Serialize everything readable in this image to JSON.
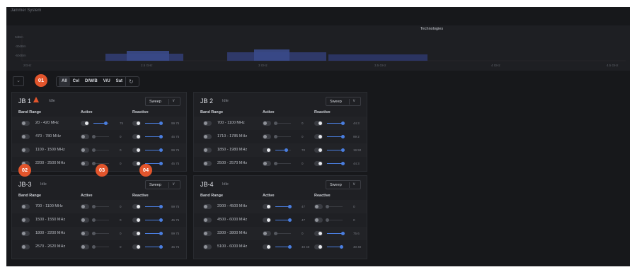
{
  "app": {
    "title": "Jammer System"
  },
  "spectrum": {
    "technologies_label": "Technologies",
    "y_labels": [
      "0dBm",
      "-30dBm",
      "-60dBm"
    ],
    "freq_labels": [
      "2GHz",
      "2.5 GHz",
      "3 GHz",
      "3.5 GHz",
      "4 GHz",
      "4.5 GHz"
    ]
  },
  "toolbar": {
    "filters": [
      "All",
      "Cel",
      "D/W/B",
      "V/U",
      "Sat"
    ],
    "selected_filter": "All"
  },
  "badges": [
    "01",
    "02",
    "03",
    "04"
  ],
  "panels": [
    {
      "title": "JB 1",
      "status": "Idle",
      "warning": true,
      "mode": "Sweep",
      "headers": {
        "band": "Band Range",
        "active": "Active",
        "reactive": "Reactive"
      },
      "rows": [
        {
          "band": "20 - 420 MHz",
          "active_on": true,
          "active_level": 0.75,
          "active_val": "75",
          "reactive_on": true,
          "reactive_level": 1.0,
          "reactive_val": "99 75"
        },
        {
          "band": "470 - 780 MHz",
          "active_on": false,
          "active_level": 0.0,
          "active_val": "0",
          "reactive_on": true,
          "reactive_level": 1.0,
          "reactive_val": "45 75"
        },
        {
          "band": "1100 - 1500 MHz",
          "active_on": false,
          "active_level": 0.0,
          "active_val": "0",
          "reactive_on": true,
          "reactive_level": 1.0,
          "reactive_val": "99 75"
        },
        {
          "band": "2200 - 2500 MHz",
          "active_on": false,
          "active_level": 0.0,
          "active_val": "0",
          "reactive_on": true,
          "reactive_level": 1.0,
          "reactive_val": "45 75"
        }
      ]
    },
    {
      "title": "JB 2",
      "status": "Idle",
      "warning": false,
      "mode": "Sweep",
      "headers": {
        "band": "Band Range",
        "active": "Active",
        "reactive": "Reactive"
      },
      "rows": [
        {
          "band": "700 - 1100 MHz",
          "active_on": false,
          "active_level": 0.0,
          "active_val": "0",
          "reactive_on": true,
          "reactive_level": 1.0,
          "reactive_val": "44 3"
        },
        {
          "band": "1710 - 1785 MHz",
          "active_on": false,
          "active_level": 0.0,
          "active_val": "0",
          "reactive_on": true,
          "reactive_level": 1.0,
          "reactive_val": "99 2"
        },
        {
          "band": "1850 - 1980 MHz",
          "active_on": true,
          "active_level": 0.7,
          "active_val": "70",
          "reactive_on": true,
          "reactive_level": 1.0,
          "reactive_val": "19 50"
        },
        {
          "band": "2500 - 2570 MHz",
          "active_on": false,
          "active_level": 0.0,
          "active_val": "0",
          "reactive_on": true,
          "reactive_level": 1.0,
          "reactive_val": "44 3"
        }
      ]
    },
    {
      "title": "JB-3",
      "status": "Idle",
      "warning": false,
      "mode": "Sweep",
      "headers": {
        "band": "Band Range",
        "active": "Active",
        "reactive": "Reactive"
      },
      "rows": [
        {
          "band": "700 - 1100 MHz",
          "active_on": false,
          "active_level": 0.0,
          "active_val": "0",
          "reactive_on": true,
          "reactive_level": 1.0,
          "reactive_val": "99 75"
        },
        {
          "band": "1500 - 1550 MHz",
          "active_on": false,
          "active_level": 0.0,
          "active_val": "0",
          "reactive_on": true,
          "reactive_level": 1.0,
          "reactive_val": "45 75"
        },
        {
          "band": "1800 - 2200 MHz",
          "active_on": false,
          "active_level": 0.0,
          "active_val": "0",
          "reactive_on": true,
          "reactive_level": 1.0,
          "reactive_val": "99 75"
        },
        {
          "band": "2570 - 2620 MHz",
          "active_on": false,
          "active_level": 0.0,
          "active_val": "0",
          "reactive_on": true,
          "reactive_level": 1.0,
          "reactive_val": "45 75"
        }
      ]
    },
    {
      "title": "JB-4",
      "status": "Idle",
      "warning": false,
      "mode": "Sweep",
      "headers": {
        "band": "Band Range",
        "active": "Active",
        "reactive": "Reactive"
      },
      "rows": [
        {
          "band": "2900 - 4500 MHz",
          "active_on": true,
          "active_level": 0.9,
          "active_val": "47",
          "reactive_on": false,
          "reactive_level": 0.0,
          "reactive_val": "0"
        },
        {
          "band": "4500 - 6000 MHz",
          "active_on": true,
          "active_level": 0.9,
          "active_val": "47",
          "reactive_on": false,
          "reactive_level": 0.0,
          "reactive_val": "0"
        },
        {
          "band": "3300 - 3800 MHz",
          "active_on": false,
          "active_level": 0.0,
          "active_val": "0",
          "reactive_on": true,
          "reactive_level": 1.0,
          "reactive_val": "75 6"
        },
        {
          "band": "5100 - 6000 MHz",
          "active_on": true,
          "active_level": 0.9,
          "active_val": "40 40",
          "reactive_on": true,
          "reactive_level": 0.9,
          "reactive_val": "40 40"
        }
      ]
    }
  ],
  "colors": {
    "accent": "#4a7ee0",
    "badge": "#e2552c",
    "background": "#17181b",
    "panel": "#1f2024"
  }
}
